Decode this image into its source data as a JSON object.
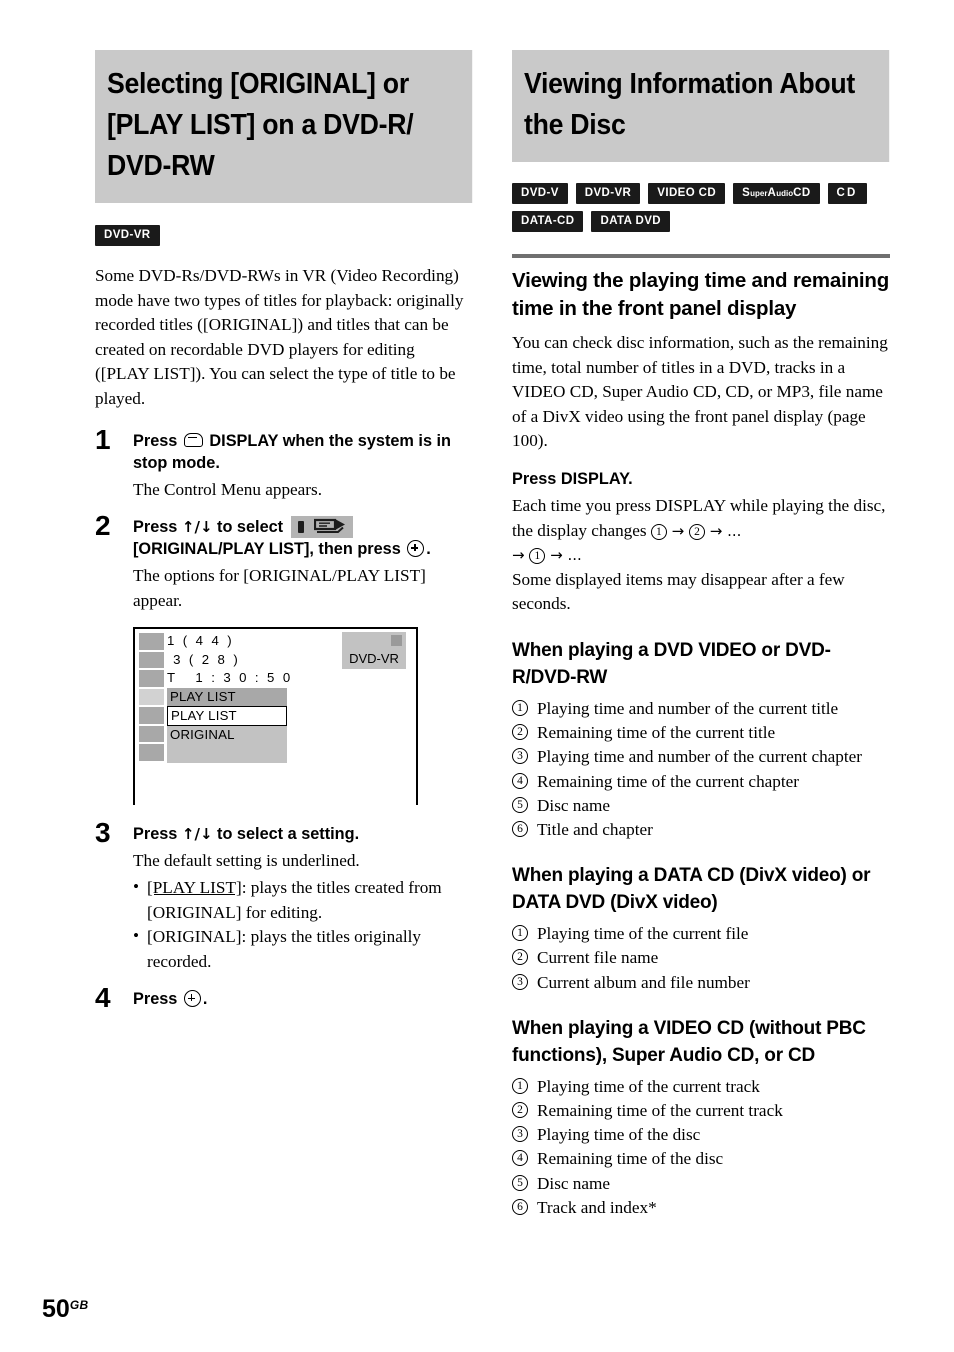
{
  "page": {
    "number": "50",
    "region_suffix": "GB"
  },
  "left_column": {
    "chapter_title_lines": [
      "Selecting [ORIGINAL] or",
      "[PLAY LIST] on a DVD-R/",
      "DVD-RW"
    ],
    "badges": [
      {
        "label": "DVD-VR",
        "style": "plain"
      }
    ],
    "intro": "Some DVD-Rs/DVD-RWs in VR (Video Recording) mode have two types of titles for playback: originally recorded titles ([ORIGINAL]) and titles that can be created on recordable DVD players for editing ([PLAY LIST]). You can select the type of title to be played.",
    "steps": [
      {
        "number": "1",
        "title_before_icon": "Press ",
        "icon": "display-icon",
        "title_after_icon": " DISPLAY when the system is in stop mode.",
        "body": "The Control Menu appears."
      },
      {
        "number": "2",
        "title_part1": "Press ",
        "arrows": "↑/↓",
        "title_part2": " to select ",
        "icon": "original-play-list-icon",
        "title_part3": " [ORIGINAL/PLAY LIST], then press ",
        "icon2": "enter-icon",
        "title_part4": ".",
        "body": "The options for [ORIGINAL/PLAY LIST] appear."
      },
      {
        "number": "3",
        "title_part1": "Press ",
        "arrows": "↑/↓",
        "title_part2": " to select a setting.",
        "body": "The default setting is underlined.",
        "bullets": [
          {
            "term": "[PLAY LIST]",
            "underlined": true,
            "text": ": plays the titles created from [ORIGINAL] for editing."
          },
          {
            "term": "[ORIGINAL]",
            "underlined": false,
            "text": ": plays the titles originally recorded."
          }
        ]
      },
      {
        "number": "4",
        "title_part1": "Press ",
        "icon": "enter-icon",
        "title_part4": "."
      }
    ],
    "osd_screen": {
      "line1": "1 ( 4 4 )",
      "line2": " 3 ( 2 8 )",
      "line3": "T   1 : 3 0 : 5 0",
      "selected_row": "PLAY LIST",
      "option_highlighted": "PLAY LIST",
      "option_other": "ORIGINAL",
      "disc_label": "DVD-VR"
    }
  },
  "right_column": {
    "chapter_title_lines": [
      "Viewing Information About",
      "the Disc"
    ],
    "badges_row1": [
      {
        "label": "DVD-V",
        "style": "plain"
      },
      {
        "label": "DVD-VR",
        "style": "plain"
      },
      {
        "label": "VIDEO CD",
        "style": "plain"
      },
      {
        "label": "Super Audio CD",
        "style": "superaudio"
      },
      {
        "label": "CD",
        "style": "wide"
      }
    ],
    "badges_row2": [
      {
        "label": "DATA-CD",
        "style": "plain"
      },
      {
        "label": "DATA DVD",
        "style": "plain"
      }
    ],
    "section_heading": "Viewing the playing time and remaining time in the front panel display",
    "section_intro": "You can check disc information, such as the remaining time, total number of titles in a DVD, tracks in a VIDEO CD, Super Audio CD, CD, or MP3, file name of a DivX video using the front panel display (page 100).",
    "press_display": "Press DISPLAY.",
    "display_cycle_text_a": "Each time you press DISPLAY while playing the disc, the display changes ",
    "display_cycle_text_b": " → ",
    "display_cycle_text_c": " → ...",
    "display_cycle_text_d": "→ ",
    "display_cycle_text_e": " → ...",
    "display_cycle_note": "Some displayed items may disappear after a few seconds.",
    "subsections": [
      {
        "heading": "When playing a DVD VIDEO or DVD-R/DVD-RW",
        "items": [
          "Playing time and number of the current title",
          "Remaining time of the current title",
          "Playing time and number of the current chapter",
          "Remaining time of the current chapter",
          "Disc name",
          "Title and chapter"
        ]
      },
      {
        "heading": "When playing a DATA CD (DivX video) or DATA DVD (DivX video)",
        "items": [
          "Playing time of the current file",
          "Current file name",
          "Current album and file number"
        ]
      },
      {
        "heading": "When playing a VIDEO CD (without PBC functions), Super Audio CD, or CD",
        "items": [
          "Playing time of the current track",
          "Remaining time of the current track",
          "Playing time of the disc",
          "Remaining time of the disc",
          "Disc name",
          "Track and index*"
        ]
      }
    ],
    "circled_numerals": [
      "①",
      "②",
      "③",
      "④",
      "⑤",
      "⑥"
    ]
  },
  "colors": {
    "heading_band": "#c9c9c9",
    "badge_bg": "#1a1a1a",
    "rule": "#6f6f6f",
    "osd_row": "#c2c2c2",
    "osd_row_selected": "#a8a8a8"
  }
}
